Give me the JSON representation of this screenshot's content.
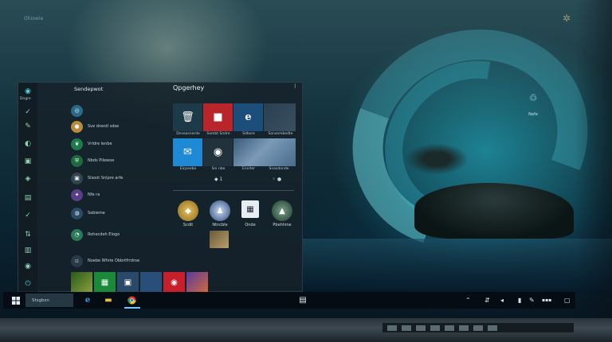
{
  "desktop": {
    "top_label": "Ohiowie",
    "desktop_icon_label": "Nafe",
    "top_right_icon": "gear-icon"
  },
  "start_menu": {
    "rail_user_label": "Dngre",
    "apps_title": "Sendepwot",
    "apps": [
      {
        "label": "",
        "color": "#2a6a88",
        "icon": "compass-icon"
      },
      {
        "label": "Sve dnestl sdse",
        "color": "#b88c3a",
        "icon": "circle-icon"
      },
      {
        "label": "Vrldre lenbe",
        "color": "#1e7a4a",
        "icon": "leaf-icon"
      },
      {
        "label": "Nbds Pilewoe",
        "color": "#1e6a3e",
        "icon": "shield-icon"
      },
      {
        "label": "Slsoot Snlpre arfe",
        "color": "#34444e",
        "icon": "box-icon"
      },
      {
        "label": "Nfe ra",
        "color": "#5a3e8a",
        "icon": "star-icon"
      },
      {
        "label": "Sabieme",
        "color": "#2a4a66",
        "icon": "globe-icon"
      },
      {
        "label": "Rohecdeh Elogo",
        "color": "#2a7a5a",
        "icon": "chat-icon"
      },
      {
        "label": "Noebe Whrle Obbrtfrrdroe",
        "color": "#2a3a46",
        "icon": "doc-icon"
      }
    ],
    "tiles_title": "Qpgerhey",
    "tiles": [
      {
        "label": "Dnseosnerde",
        "glyph": "🗑",
        "color": "#1d3a48"
      },
      {
        "label": "Sambt Sndre",
        "glyph": "■",
        "color": "#b8262c"
      },
      {
        "label": "Sdbore",
        "glyph": "e",
        "color": "#1b4e7a"
      },
      {
        "label": "Sonsembedte",
        "glyph": "",
        "color": "#2a4050"
      },
      {
        "label": "Elcpeebe",
        "glyph": "✉",
        "color": "#1e8ad6"
      },
      {
        "label": "Sni nbe",
        "glyph": "◉",
        "color": "#22323c"
      },
      {
        "label": "Enniter",
        "glyph": "",
        "color": "#5a7a9a"
      },
      {
        "label": "Snasdonde",
        "glyph": "",
        "color": "#6a8aa8"
      }
    ],
    "tile_mini_left": "◆ 1",
    "tile_mini_right": "⁘ ●",
    "circles": [
      {
        "label": "Scdit",
        "color": "#b88a2a"
      },
      {
        "label": "Ntncble",
        "color": "#3a6a9a"
      },
      {
        "label": "Onde",
        "color": "#3a4a54"
      },
      {
        "label": "Pbehhine",
        "color": "#2a5a4a"
      }
    ],
    "bottom_tiles": [
      {
        "color": "#4a6a2a"
      },
      {
        "color": "#1a8a3a"
      },
      {
        "color": "#2a4a6a"
      },
      {
        "color": "#2a4e7a"
      },
      {
        "color": "#c8202a"
      },
      {
        "color": "#5a3aa0"
      }
    ]
  },
  "taskbar": {
    "search_placeholder": "Stsgbsn",
    "tray_time": "▪▪▪"
  }
}
